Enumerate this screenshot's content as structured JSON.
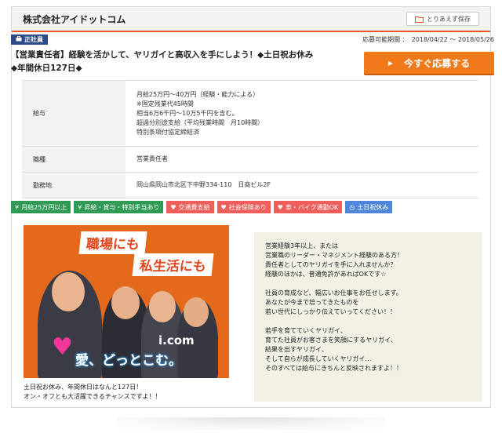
{
  "header": {
    "company": "株式会社アイドットコム",
    "save_label": "とりあえず保存"
  },
  "badge": {
    "label": "正社員"
  },
  "period": {
    "label": "応募可能期間 ：",
    "value": "2018/04/22 ～ 2018/05/26"
  },
  "job_title": "【営業責任者】経験を活かして、ヤリガイと高収入を手にしよう！◆土日祝お休み◆年間休日127日◆",
  "apply_button": "今すぐ応募する",
  "info": {
    "salary": {
      "key": "給与",
      "lines": [
        "月給25万円～40万円（経験・能力による）",
        "※固定残業代45時間",
        "相当6万6千円～10万5千円を含む。",
        "超過分別途支給（平均残業時間　月10時間）",
        "特別条項付協定締結済"
      ]
    },
    "type": {
      "key": "職種",
      "value": "営業責任者"
    },
    "location": {
      "key": "勤務地",
      "value": "岡山県岡山市北区下中野334-110　日商ビル2F"
    }
  },
  "tags": [
    {
      "label": "月給25万円以上",
      "color": "#2e9a53",
      "icon": "yen"
    },
    {
      "label": "昇給・賞与・特別手当あり",
      "color": "#2e9a53",
      "icon": "yen"
    },
    {
      "label": "交通費支給",
      "color": "#ee5f5b",
      "icon": "heart"
    },
    {
      "label": "社会保険あり",
      "color": "#ee5f5b",
      "icon": "heart"
    },
    {
      "label": "車・バイク通勤OK",
      "color": "#ee5f5b",
      "icon": "heart"
    },
    {
      "label": "土日祝休み",
      "color": "#4f86d9",
      "icon": "clock"
    }
  ],
  "photo": {
    "line1": "職場にも",
    "line2": "私生活にも",
    "brand": "i.com",
    "slogan": "愛、どっとこむ。"
  },
  "caption": [
    "土日祝お休み、年間休日はなんと127日！",
    "オン・オフとも大活躍できるチャンスですよ！！"
  ],
  "description": [
    [
      "営業経験3年以上、または",
      "営業職のリーダー・マネジメント経験のある方！",
      "責任者としてのヤリガイを手に入れませんか？",
      "経験のほかは、普通免許があればOKです☆"
    ],
    [
      "社員の育成など、幅広いお仕事をお任せします。",
      "あなたが今まで培ってきたものを",
      "若い世代にしっかり伝えていってください！！"
    ],
    [
      "若手を育てていくヤリガイ、",
      "育てた社員がお客さまを笑顔にするヤリガイ、",
      "結果を出すヤリガイ、",
      "そして自らが成長していくヤリガイ…",
      "そのすべては給与にきちんと反映されますよ！！"
    ]
  ]
}
